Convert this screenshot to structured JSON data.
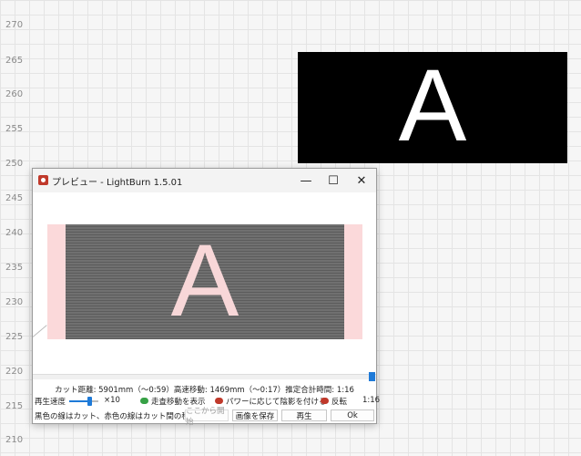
{
  "ruler": {
    "labels": [
      "270",
      "265",
      "260",
      "255",
      "250",
      "245",
      "240",
      "235",
      "230",
      "225",
      "220",
      "215",
      "210"
    ]
  },
  "design": {
    "letter": "A"
  },
  "window": {
    "title": "プレビュー - LightBurn 1.5.01",
    "controls": {
      "minimize": "—",
      "maximize": "☐",
      "close": "✕"
    },
    "preview_letter": "A",
    "progress": 1.0,
    "stats": "カット距離: 5901mm（～0:59）高速移動: 1469mm（～0:17）推定合計時間: 1:16",
    "speed_label": "再生速度",
    "speed_multiplier": "×10",
    "speed_level": 0.7,
    "options": {
      "show_rapid": "走査移動を表示",
      "shade_by_power": "パワーに応じて陰影を付ける",
      "invert": "反転"
    },
    "time_display": "1:16",
    "legend": "黒色の線はカット、赤色の線はカット間の移動です",
    "buttons": {
      "start_here": "ここから開始",
      "save_image": "画像を保存",
      "play": "再生",
      "ok": "Ok"
    },
    "colors": {
      "accent": "#1e7ad8",
      "toggle_on": "#37a146",
      "toggle_off": "#c0392b",
      "preview_pink": "#fbd9da"
    }
  }
}
